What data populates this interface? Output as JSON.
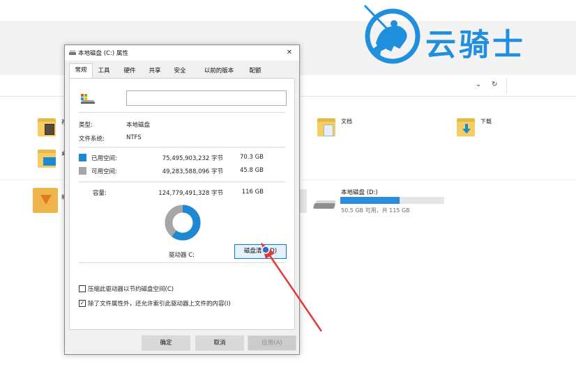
{
  "explorer": {
    "folders": [
      {
        "label": "视"
      },
      {
        "label": "桌"
      },
      {
        "label": "文档"
      },
      {
        "label": "下载"
      }
    ],
    "quick_label": "新",
    "drive": {
      "name": "本地磁盘 (D:)",
      "usage_fraction": 0.57,
      "info": "50.5 GB 可用，共 115 GB"
    },
    "nav": {
      "down": "⌄",
      "refresh": "↻"
    }
  },
  "logo": {
    "text": "云骑士",
    "color": "#1f8fde"
  },
  "dialog": {
    "title": "本地磁盘 (C:) 属性",
    "close": "✕",
    "tabs": [
      "常规",
      "工具",
      "硬件",
      "共享",
      "安全",
      "以前的版本",
      "配额"
    ],
    "active_tab": "常规",
    "name_value": "",
    "type_label": "类型:",
    "type_value": "本地磁盘",
    "fs_label": "文件系统:",
    "fs_value": "NTFS",
    "used": {
      "label": "已用空间:",
      "bytes": "75,495,903,232 字节",
      "size": "70.3 GB",
      "color": "#1e88d2"
    },
    "free": {
      "label": "可用空间:",
      "bytes": "49,283,588,096 字节",
      "size": "45.8 GB",
      "color": "#a6a6a6"
    },
    "capacity": {
      "label": "容量:",
      "bytes": "124,779,491,328 字节",
      "size": "116 GB"
    },
    "used_fraction": 0.605,
    "drive_label": "驱动器 C:",
    "cleanup_button": "磁盘清理(D)",
    "compress_label": "压缩此驱动器以节约磁盘空间(C)",
    "compress_checked": false,
    "index_label": "除了文件属性外，还允许索引此驱动器上文件的内容(I)",
    "index_checked": true,
    "ok": "确定",
    "cancel": "取消",
    "apply": "应用(A)"
  },
  "colors": {
    "accent": "#0078d7",
    "arrow": "#e53935"
  }
}
